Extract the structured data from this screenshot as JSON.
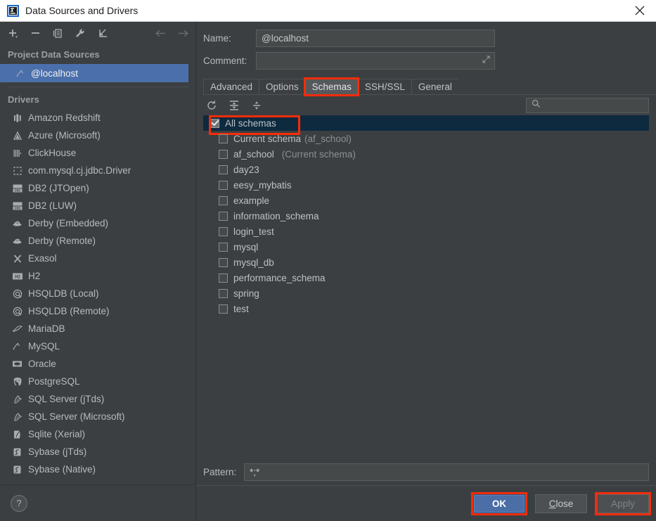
{
  "window": {
    "title": "Data Sources and Drivers",
    "logo_icon": "intellij-idea-logo",
    "close_icon": "close-icon"
  },
  "sidebar": {
    "toolbar": [
      {
        "name": "add-data-source-button",
        "icon": "plus-icon",
        "enabled": true
      },
      {
        "name": "remove-data-source-button",
        "icon": "minus-icon",
        "enabled": true
      },
      {
        "name": "copy-data-source-button",
        "icon": "copy-icon",
        "enabled": true
      },
      {
        "name": "properties-button",
        "icon": "wrench-icon",
        "enabled": true
      },
      {
        "name": "import-button",
        "icon": "import-arrow-icon",
        "enabled": true
      },
      {
        "name": "navigate-back-button",
        "icon": "arrow-left-icon",
        "enabled": false
      },
      {
        "name": "navigate-forward-button",
        "icon": "arrow-right-icon",
        "enabled": false
      }
    ],
    "project_group_label": "Project Data Sources",
    "data_sources": [
      {
        "label": "@localhost",
        "icon": "mysql-icon",
        "selected": true
      }
    ],
    "drivers_group_label": "Drivers",
    "drivers": [
      {
        "label": "Amazon Redshift",
        "icon": "redshift-icon"
      },
      {
        "label": "Azure (Microsoft)",
        "icon": "azure-icon"
      },
      {
        "label": "ClickHouse",
        "icon": "clickhouse-icon"
      },
      {
        "label": "com.mysql.cj.jdbc.Driver",
        "icon": "generic-driver-icon"
      },
      {
        "label": "DB2 (JTOpen)",
        "icon": "db2-icon"
      },
      {
        "label": "DB2 (LUW)",
        "icon": "db2-icon"
      },
      {
        "label": "Derby (Embedded)",
        "icon": "derby-icon"
      },
      {
        "label": "Derby (Remote)",
        "icon": "derby-icon"
      },
      {
        "label": "Exasol",
        "icon": "exasol-icon"
      },
      {
        "label": "H2",
        "icon": "h2-icon"
      },
      {
        "label": "HSQLDB (Local)",
        "icon": "hsqldb-icon"
      },
      {
        "label": "HSQLDB (Remote)",
        "icon": "hsqldb-icon"
      },
      {
        "label": "MariaDB",
        "icon": "mariadb-icon"
      },
      {
        "label": "MySQL",
        "icon": "mysql-icon"
      },
      {
        "label": "Oracle",
        "icon": "oracle-icon"
      },
      {
        "label": "PostgreSQL",
        "icon": "postgresql-icon"
      },
      {
        "label": "SQL Server (jTds)",
        "icon": "sqlserver-icon"
      },
      {
        "label": "SQL Server (Microsoft)",
        "icon": "sqlserver-icon"
      },
      {
        "label": "Sqlite (Xerial)",
        "icon": "sqlite-icon"
      },
      {
        "label": "Sybase (jTds)",
        "icon": "sybase-icon"
      },
      {
        "label": "Sybase (Native)",
        "icon": "sybase-icon"
      }
    ],
    "help_button_label": "?"
  },
  "details": {
    "name_label": "Name:",
    "name_value": "@localhost",
    "comment_label": "Comment:",
    "comment_value": "",
    "comment_expand_icon": "expand-icon",
    "tabs": [
      {
        "label": "General",
        "active": false,
        "annotated": false
      },
      {
        "label": "SSH/SSL",
        "active": false,
        "annotated": false
      },
      {
        "label": "Schemas",
        "active": true,
        "annotated": true
      },
      {
        "label": "Options",
        "active": false,
        "annotated": false
      },
      {
        "label": "Advanced",
        "active": false,
        "annotated": false
      }
    ]
  },
  "schemas_tab": {
    "toolbar": [
      {
        "name": "refresh-schemas-button",
        "icon": "refresh-icon"
      },
      {
        "name": "expand-all-button",
        "icon": "expand-all-icon"
      },
      {
        "name": "collapse-all-button",
        "icon": "collapse-all-icon"
      }
    ],
    "search_placeholder": "",
    "search_value": "",
    "search_icon": "search-icon",
    "items": [
      {
        "label": "All schemas",
        "note": "",
        "checked": true,
        "selected": true,
        "annotated": true,
        "indented": false
      },
      {
        "label": "Current schema",
        "note": "(af_school)",
        "checked": false,
        "selected": false,
        "annotated": false,
        "indented": true
      },
      {
        "label": "af_school",
        "note": "(Current schema)",
        "checked": false,
        "selected": false,
        "annotated": false,
        "indented": true
      },
      {
        "label": "day23",
        "note": "",
        "checked": false,
        "selected": false,
        "annotated": false,
        "indented": true
      },
      {
        "label": "eesy_mybatis",
        "note": "",
        "checked": false,
        "selected": false,
        "annotated": false,
        "indented": true
      },
      {
        "label": "example",
        "note": "",
        "checked": false,
        "selected": false,
        "annotated": false,
        "indented": true
      },
      {
        "label": "information_schema",
        "note": "",
        "checked": false,
        "selected": false,
        "annotated": false,
        "indented": true
      },
      {
        "label": "login_test",
        "note": "",
        "checked": false,
        "selected": false,
        "annotated": false,
        "indented": true
      },
      {
        "label": "mysql",
        "note": "",
        "checked": false,
        "selected": false,
        "annotated": false,
        "indented": true
      },
      {
        "label": "mysql_db",
        "note": "",
        "checked": false,
        "selected": false,
        "annotated": false,
        "indented": true
      },
      {
        "label": "performance_schema",
        "note": "",
        "checked": false,
        "selected": false,
        "annotated": false,
        "indented": true
      },
      {
        "label": "spring",
        "note": "",
        "checked": false,
        "selected": false,
        "annotated": false,
        "indented": true
      },
      {
        "label": "test",
        "note": "",
        "checked": false,
        "selected": false,
        "annotated": false,
        "indented": true
      }
    ],
    "pattern_label": "Pattern:",
    "pattern_value": "*;*"
  },
  "footer": {
    "ok_label": "OK",
    "close_label": "Close",
    "close_mnemonic": "C",
    "apply_label": "Apply",
    "apply_enabled": false
  },
  "colors": {
    "window_background": "#3c3f41",
    "titlebar_background": "#ffffff",
    "selection_blue": "#4a6fab",
    "row_selected_navy": "#0d2a3f",
    "annotation_red": "#f72c0a",
    "primary_button": "#4a6ea5",
    "text_primary": "#bdc1c4",
    "text_muted": "#8b9094"
  }
}
